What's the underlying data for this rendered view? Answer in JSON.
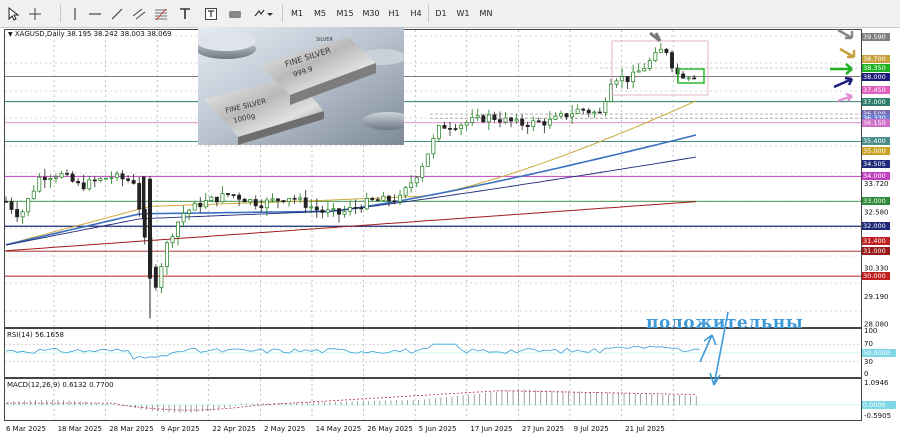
{
  "toolbar": {
    "timeframes": [
      "M1",
      "M5",
      "M15",
      "M30",
      "H1",
      "H4",
      "D1",
      "W1",
      "MN"
    ]
  },
  "chart": {
    "symbol_info": "XAGUSD,Daily  38.195 38.242 38.003 38.069",
    "annotation": "положительны",
    "rsi_label": "RSI(14) 56.1658",
    "macd_label": "MACD(12,26,9) 0.6132 0.7700",
    "price_axis": [
      "39.590",
      "38.700",
      "38.350",
      "38.000",
      "37.450",
      "37.000",
      "36.500",
      "36.330",
      "36.150",
      "35.400",
      "35.000",
      "34.505",
      "34.000",
      "33.720",
      "33.000",
      "32.580",
      "32.000",
      "31.400",
      "31.000",
      "30.330",
      "30.000",
      "29.190",
      "28.080"
    ],
    "rsi_axis": [
      "100",
      "70",
      "50.0000",
      "30",
      "0"
    ],
    "macd_axis": [
      "1.0946",
      "0.0000",
      "-0.5905"
    ],
    "dates": [
      "6 Mar 2025",
      "18 Mar 2025",
      "28 Mar 2025",
      "9 Apr 2025",
      "22 Apr 2025",
      "2 May 2025",
      "14 May 2025",
      "26 May 2025",
      "5 Jun 2025",
      "17 Jun 2025",
      "27 Jun 2025",
      "9 Jul 2025",
      "21 Jul 2025"
    ],
    "photo_text": {
      "bar1": "FINE SILVER",
      "bar1_b": "999.9",
      "bar2": "FINE SILVER",
      "bar2_b": "1000g",
      "side": "SILVER"
    }
  },
  "colors": {
    "bull": "#1a7d1a",
    "bear": "#222222",
    "ma_gold": "#c9a227",
    "ma_blue": "#3a6fc0",
    "ma_navy": "#1f2a7a",
    "ma_red": "#a31e1e",
    "annotation": "#3e9bd8"
  }
}
